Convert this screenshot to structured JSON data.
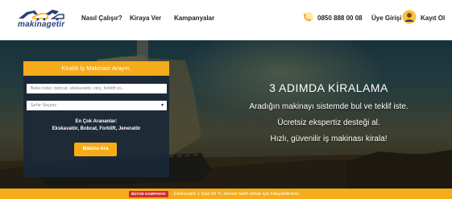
{
  "brand": {
    "logo_text": "makinagetir",
    "logo_icon": "excavator-logo-icon",
    "accent_color": "#f5ac1b",
    "logo_color": "#2a3f7a"
  },
  "nav": {
    "items": [
      {
        "label": "Nasıl Çalışır?"
      },
      {
        "label": "Kiraya Ver"
      },
      {
        "label": "Kampanyalar"
      }
    ]
  },
  "header_right": {
    "phone_icon": "phone-icon",
    "phone": "0850 888 00 08",
    "login_label": "Üye Girişi",
    "user_icon": "user-avatar-icon",
    "register_label": "Kayıt Ol"
  },
  "search": {
    "heading": "Kiralık İş Makinası Arayın.",
    "query_placeholder": "Beko loder, bobcat, ekskavatör, vinç, forklift vs...",
    "city_selected": "Şehir Seçiniz",
    "popular_label": "En Çok Arananlar:",
    "popular_items": "Ekskavatör, Bobcat, Forklift, Jeneratör",
    "button_label": "Makine Ara"
  },
  "hero": {
    "title": "3 ADIMDA KİRALAMA",
    "lines": [
      "Aradığın makinayı sistemde bul ve teklif iste.",
      "Ücretsiz ekspertiz desteği al.",
      "Hızlı, güvenilir iş makinası kirala!"
    ]
  },
  "banner": {
    "badge": "BÜYÜK KAMPANYA",
    "badge_color": "#d42b2b",
    "text": "Ekskavatör 1 Saat 85 TL Hemen teklif almak için tıklayabilirsiniz."
  }
}
